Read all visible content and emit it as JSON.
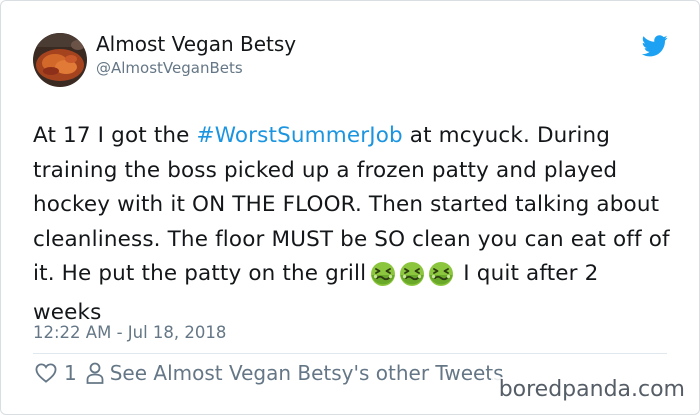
{
  "user": {
    "display_name": "Almost Vegan Betsy",
    "handle": "@AlmostVeganBets",
    "avatar_icon": "profile-photo-food"
  },
  "tweet": {
    "text_before": "At 17 I got the ",
    "hashtag": "#WorstSummerJob",
    "text_after": " at mcyuck. During training the boss picked up a frozen patty and played hockey with it ON THE FLOOR. Then started talking about cleanliness. The floor MUST be SO clean you can eat off of it. He put the patty on the grill",
    "emoji_name": "nauseated-face",
    "emoji_count": 3,
    "text_end": "I quit after 2 weeks",
    "timestamp": "12:22 AM - Jul 18, 2018"
  },
  "actions": {
    "like_count": "1",
    "other_tweets_label": "See Almost Vegan Betsy's other Tweets"
  },
  "brand": {
    "twitter_icon": "twitter-bird",
    "twitter_color": "#1da1f2",
    "link_color": "#1b95e0",
    "watermark": "boredpanda.com"
  }
}
